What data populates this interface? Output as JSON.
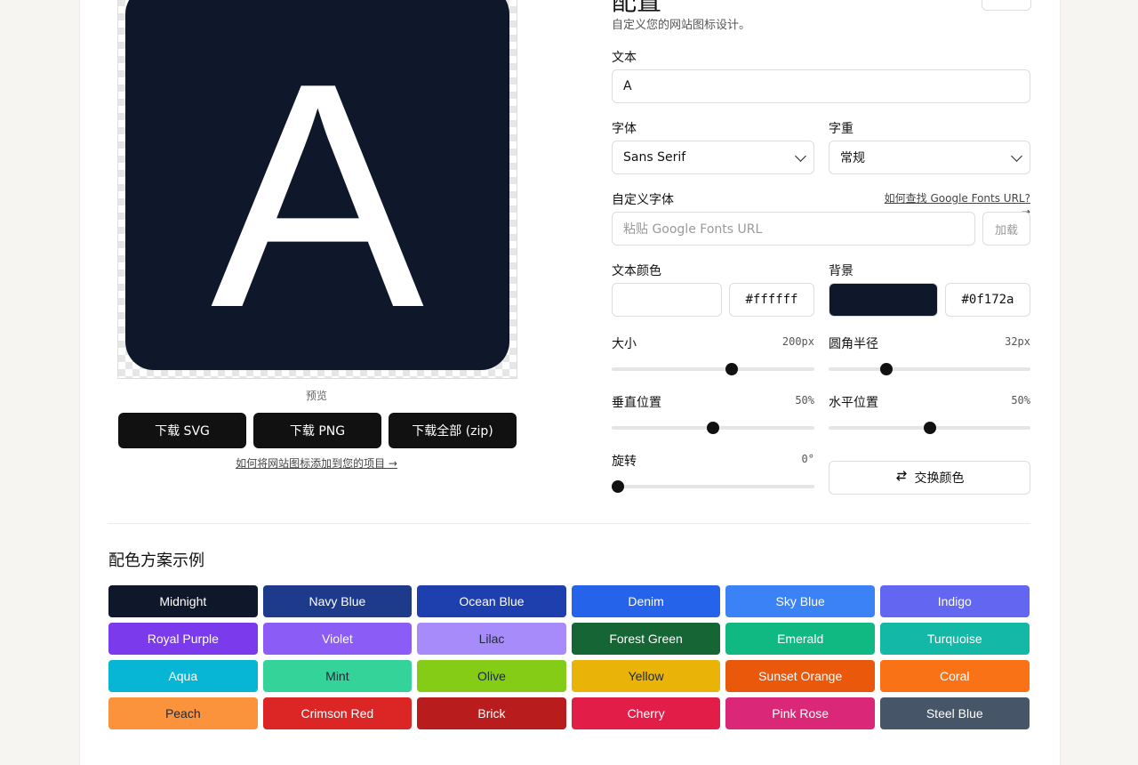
{
  "heading": "配置",
  "subheading": "自定义您的网站图标设计。",
  "preview": {
    "letter": "A",
    "text_color": "#ffffff",
    "bg_color": "#0f172a",
    "caption": "预览"
  },
  "downloads": {
    "svg": "下载 SVG",
    "png": "下载 PNG",
    "zip": "下载全部 (zip)",
    "help": "如何将网站图标添加到您的项目 →"
  },
  "text_field": {
    "label": "文本",
    "value": "A"
  },
  "font": {
    "label": "字体",
    "value": "Sans Serif"
  },
  "weight": {
    "label": "字重",
    "value": "常规"
  },
  "custom_font": {
    "label": "自定义字体",
    "help": "如何查找 Google Fonts URL? →",
    "placeholder": "粘贴 Google Fonts URL",
    "load": "加载"
  },
  "text_color": {
    "label": "文本颜色",
    "hex": "#ffffff",
    "swatch": "#ffffff"
  },
  "background": {
    "label": "背景",
    "hex": "#0f172a",
    "swatch": "#0f172a"
  },
  "sliders": {
    "size": {
      "label": "大小",
      "value": "200px",
      "fraction": 0.6
    },
    "radius": {
      "label": "圆角半径",
      "value": "32px",
      "fraction": 0.27
    },
    "vertical": {
      "label": "垂直位置",
      "value": "50%",
      "fraction": 0.5
    },
    "horizontal": {
      "label": "水平位置",
      "value": "50%",
      "fraction": 0.5
    },
    "rotation": {
      "label": "旋转",
      "value": "0°",
      "fraction": 0.0
    }
  },
  "swap": {
    "label": "交换颜色",
    "icon": "swap-arrows-icon"
  },
  "palette": {
    "title": "配色方案示例",
    "items": [
      {
        "name": "Midnight",
        "bg": "#0f172a",
        "fg": "#ffffff"
      },
      {
        "name": "Navy Blue",
        "bg": "#1e3a8a",
        "fg": "#ffffff"
      },
      {
        "name": "Ocean Blue",
        "bg": "#1e40af",
        "fg": "#ffffff"
      },
      {
        "name": "Denim",
        "bg": "#2563eb",
        "fg": "#ffffff"
      },
      {
        "name": "Sky Blue",
        "bg": "#3b82f6",
        "fg": "#ffffff"
      },
      {
        "name": "Indigo",
        "bg": "#6366f1",
        "fg": "#ffffff"
      },
      {
        "name": "Royal Purple",
        "bg": "#7c3aed",
        "fg": "#ffffff"
      },
      {
        "name": "Violet",
        "bg": "#8b5cf6",
        "fg": "#ffffff"
      },
      {
        "name": "Lilac",
        "bg": "#a78bfa",
        "fg": "#1f2937"
      },
      {
        "name": "Forest Green",
        "bg": "#166534",
        "fg": "#ffffff"
      },
      {
        "name": "Emerald",
        "bg": "#10b981",
        "fg": "#ffffff"
      },
      {
        "name": "Turquoise",
        "bg": "#14b8a6",
        "fg": "#ffffff"
      },
      {
        "name": "Aqua",
        "bg": "#06b6d4",
        "fg": "#ffffff"
      },
      {
        "name": "Mint",
        "bg": "#34d399",
        "fg": "#1f2937"
      },
      {
        "name": "Olive",
        "bg": "#84cc16",
        "fg": "#1f2937"
      },
      {
        "name": "Yellow",
        "bg": "#eab308",
        "fg": "#1f2937"
      },
      {
        "name": "Sunset Orange",
        "bg": "#ea580c",
        "fg": "#ffffff"
      },
      {
        "name": "Coral",
        "bg": "#f97316",
        "fg": "#ffffff"
      },
      {
        "name": "Peach",
        "bg": "#fb923c",
        "fg": "#1f2937"
      },
      {
        "name": "Crimson Red",
        "bg": "#dc2626",
        "fg": "#ffffff"
      },
      {
        "name": "Brick",
        "bg": "#b91c1c",
        "fg": "#ffffff"
      },
      {
        "name": "Cherry",
        "bg": "#e11d48",
        "fg": "#ffffff"
      },
      {
        "name": "Pink Rose",
        "bg": "#db2777",
        "fg": "#ffffff"
      },
      {
        "name": "Steel Blue",
        "bg": "#475569",
        "fg": "#ffffff"
      }
    ]
  }
}
